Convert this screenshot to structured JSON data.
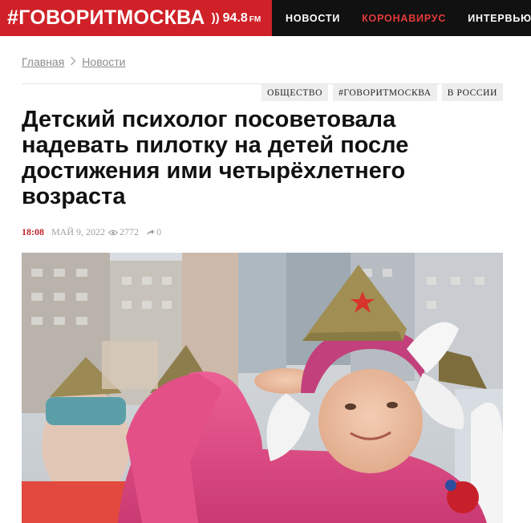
{
  "header": {
    "brand_name": "#ГОВОРИТМОСКВА",
    "brand_waves": "))",
    "frequency": "94.8",
    "frequency_unit": "FM",
    "nav": [
      {
        "label": "НОВОСТИ"
      },
      {
        "label": "КОРОНАВИРУС"
      },
      {
        "label": "ИНТЕРВЬЮ"
      }
    ]
  },
  "breadcrumb": {
    "items": [
      {
        "label": "Главная"
      },
      {
        "label": "Новости"
      }
    ],
    "separator": ">"
  },
  "tags": [
    {
      "label": "ОБЩЕСТВО"
    },
    {
      "label": "#ГОВОРИТМОСКВА"
    },
    {
      "label": "В РОССИИ"
    }
  ],
  "article": {
    "title": "Детский психолог посоветовала надевать пилотку на детей после достижения ими четырёхлетнего возраста",
    "time": "18:08",
    "date": "МАЙ 9, 2022",
    "views": "2772",
    "shares": "0"
  },
  "colors": {
    "brand_red": "#cf2127",
    "nav_dark": "#111111",
    "highlight_red": "#e43a3a",
    "time_red": "#c0262c"
  },
  "icons": {
    "views": "eye-icon",
    "shares": "share-arrow-icon",
    "crumb_sep": "chevron-right-icon"
  }
}
